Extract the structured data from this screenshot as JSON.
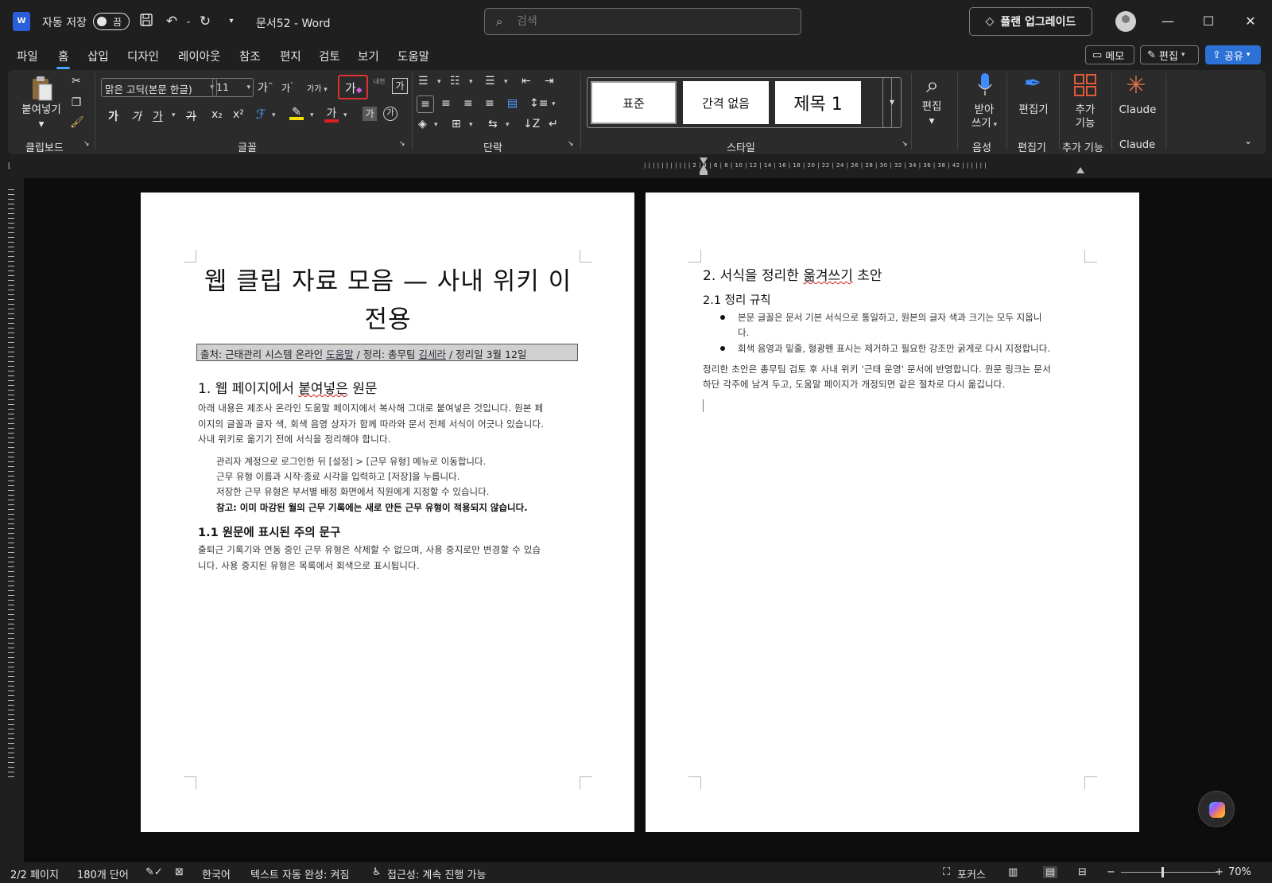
{
  "titlebar": {
    "app_logo": "W",
    "autosave_label": "자동 저장",
    "autosave_state": "끔",
    "doc_title": "문서52  -  Word",
    "search_placeholder": "검색",
    "upgrade_label": "플랜 업그레이드",
    "icons": [
      "save-icon",
      "undo-icon",
      "redo-icon",
      "customize-icon",
      "search-icon",
      "diamond-icon",
      "avatar",
      "minimize-icon",
      "maximize-icon",
      "close-icon"
    ]
  },
  "menu": {
    "tabs": [
      "파일",
      "홈",
      "삽입",
      "디자인",
      "레이아웃",
      "참조",
      "편지",
      "검토",
      "보기",
      "도움말"
    ],
    "active_tab": "홈",
    "memo_label": "메모",
    "edit_label": "편집",
    "share_label": "공유"
  },
  "ribbon": {
    "clipboard": {
      "paste_label": "붙여넣기",
      "group_label": "클립보드"
    },
    "font": {
      "font_name": "맑은 고딕(본문 한글)",
      "font_size": "11",
      "grow_glyph": "가",
      "shrink_glyph": "가",
      "case_glyph": "가가",
      "clear_format_glyph": "가",
      "phonetic_glyph": "내천",
      "enclose_glyph": "가",
      "bold_glyph": "가",
      "italic_glyph": "가",
      "underline_glyph": "가",
      "strike_glyph": "가",
      "subscript_glyph": "x₂",
      "superscript_glyph": "x²",
      "font_color_glyph": "가",
      "shading_glyph": "가",
      "circle_glyph": "가",
      "group_label": "글꼴"
    },
    "paragraph": {
      "group_label": "단락"
    },
    "styles": {
      "items": [
        "표준",
        "간격 없음",
        "제목 1"
      ],
      "group_label": "스타일"
    },
    "editing": {
      "label": "편집"
    },
    "voice": {
      "label_line1": "받아",
      "label_line2": "쓰기",
      "group_label": "음성"
    },
    "editor": {
      "label": "편집기",
      "group_label": "편집기"
    },
    "addins": {
      "label_line1": "추가",
      "label_line2": "기능",
      "group_label": "추가 기능"
    },
    "claude": {
      "label": "Claude",
      "group_label": "Claude"
    },
    "accent_red": "#e03030"
  },
  "ruler": {
    "ticks": "|  |  |  |  |  |  |  |  |  |  |  2 |  4 |  6 |  8 | 10 | 12 | 14 | 16 | 18 | 20 | 22 | 24 | 26 | 28 | 30 | 32 | 34 | 36 | 38 | 42 |  |  |  |  |  |"
  },
  "page1": {
    "title": "웹 클립 자료 모음 — 사내 위키 이전용",
    "source_parts": [
      "출처: 근태관리 시스템 온라인 ",
      "도움말",
      " / 정리: 총무팀 ",
      "김세라",
      " / 정리일 3월 12일"
    ],
    "h1_prefix": "1. 웹 페이지에서 ",
    "h1_squiggle": "붙여넣은",
    "h1_suffix": " 원문",
    "para1_line1": "아래 내용은 제조사 온라인 도움말 페이지에서 복사해 그대로 붙여넣은 것입니다. 원본 페",
    "para1_line2": "이지의 글꼴과 글자 색, 회색 음영 상자가 함께 따라와 문서 전체 서식이 어긋나 있습니다.",
    "para1_line3": "사내 위키로 옮기기 전에 서식을 정리해야 합니다.",
    "step1": "관리자 계정으로 로그인한 뒤 [설정] > [근무 유형] 메뉴로 이동합니다.",
    "step2": "근무 유형 이름과 시작·종료 시각을 입력하고 [저장]을 누릅니다.",
    "step3": "저장한 근무 유형은 부서별 배정 화면에서 직원에게 지정할 수 있습니다.",
    "note": "참고: 이미 마감된 월의 근무 기록에는 새로 만든 근무 유형이 적용되지 않습니다.",
    "h2": "1.1 원문에 표시된 주의 문구",
    "para2_line1": "출퇴근 기록기와 연동 중인 근무 유형은 삭제할 수 없으며, 사용 중지로만 변경할 수 있습",
    "para2_line2": "니다. 사용 중지된 유형은 목록에서 회색으로 표시됩니다."
  },
  "page2": {
    "h1_prefix": "2. 서식을 정리한 ",
    "h1_squiggle": "옮겨쓰기",
    "h1_suffix": " 초안",
    "h2": "2.1 정리 규칙",
    "bullet1_line1": "본문 글꼴은 문서 기본 서식으로 통일하고, 원본의 글자 색과 크기는 모두 지웁니",
    "bullet1_line2": "다.",
    "bullet2": "회색 음영과 밑줄, 형광펜 표시는 제거하고 필요한 강조만 굵게로 다시 지정합니다.",
    "para_line1": "정리한 초안은 총무팀 검토 후 사내 위키 '근태 운영' 문서에 반영합니다. 원문 링크는 문서",
    "para_line2": "하단 각주에 남겨 두고, 도움말 페이지가 개정되면 같은 절차로 다시 옮깁니다."
  },
  "status": {
    "page": "2/2 페이지",
    "words": "180개 단어",
    "language": "한국어",
    "autocomplete": "텍스트 자동 완성: 켜짐",
    "accessibility": "접근성: 계속 진행 가능",
    "focus": "포커스",
    "zoom": "70%"
  }
}
